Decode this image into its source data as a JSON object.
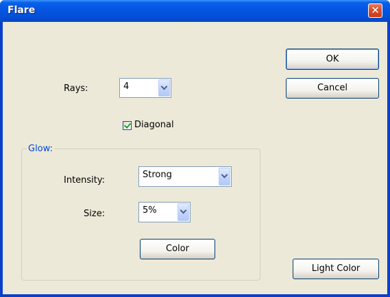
{
  "window": {
    "title": "Flare",
    "close_glyph": "✕"
  },
  "buttons": {
    "ok": "OK",
    "cancel": "Cancel",
    "color": "Color",
    "light_color": "Light Color"
  },
  "rays": {
    "label": "Rays:",
    "value": "4"
  },
  "diagonal": {
    "label": "Diagonal",
    "checked": true
  },
  "glow": {
    "legend": "Glow:",
    "intensity": {
      "label": "Intensity:",
      "value": "Strong"
    },
    "size": {
      "label": "Size:",
      "value": "5%"
    }
  },
  "icons": {
    "close": "close-icon",
    "dropdown": "chevron-down-icon",
    "check": "checkmark-icon"
  }
}
